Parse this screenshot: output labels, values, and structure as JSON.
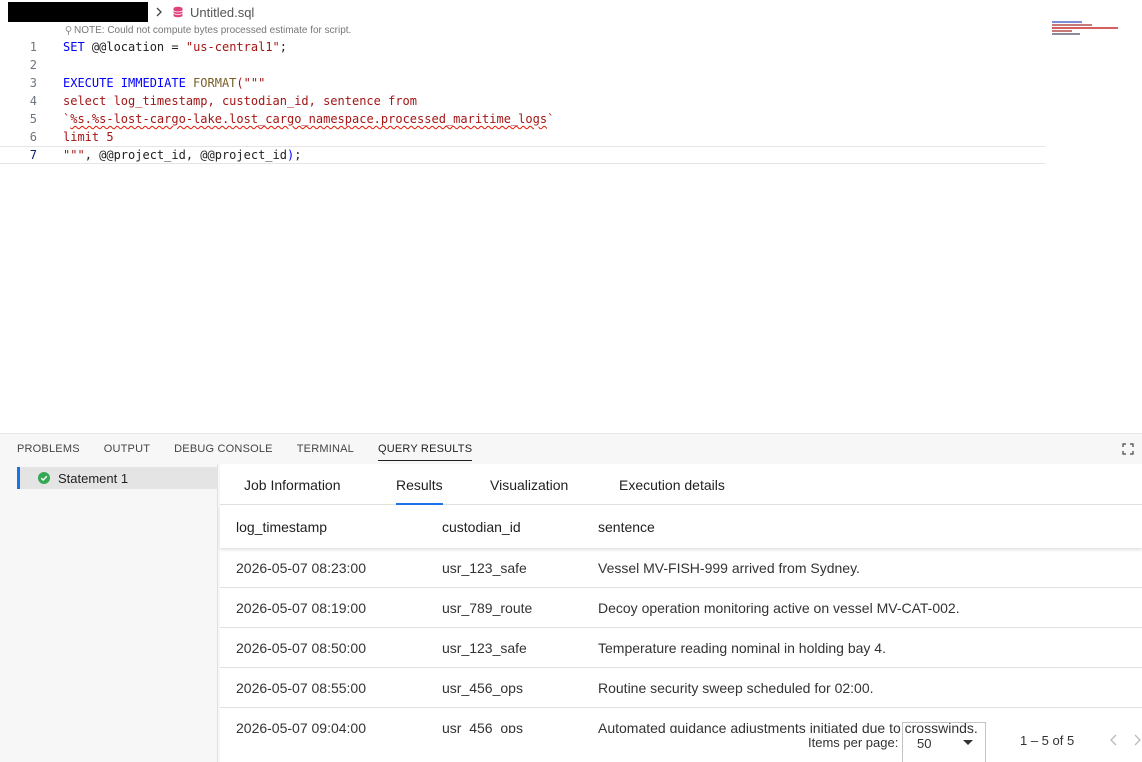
{
  "breadcrumb": {
    "file_name": "Untitled.sql"
  },
  "editor": {
    "note": "NOTE: Could not compute bytes processed estimate for script.",
    "line_numbers": [
      "1",
      "2",
      "3",
      "4",
      "5",
      "6",
      "7"
    ],
    "code": {
      "l1_kw": "SET",
      "l1_var": " @@location",
      "l1_eq": " = ",
      "l1_str": "\"us-central1\"",
      "l1_end": ";",
      "l3_kw": "EXECUTE IMMEDIATE",
      "l3_fn": " FORMAT",
      "l3_str": "(\"\"\"",
      "l4": "select log_timestamp, custodian_id, sentence from",
      "l5_tick1": "`",
      "l5_path": "%s.%s-lost-cargo-lake.lost_cargo_namespace.processed_maritime_logs",
      "l5_tick2": "`",
      "l6": "limit 5",
      "l7_str": "\"\"\"",
      "l7_rest": ", @@project_id, @@project_id",
      "l7_paren": ")",
      "l7_end": ";"
    }
  },
  "panel": {
    "tabs": [
      "PROBLEMS",
      "OUTPUT",
      "DEBUG CONSOLE",
      "TERMINAL",
      "QUERY RESULTS"
    ],
    "active_tab": "QUERY RESULTS",
    "statement": "Statement 1"
  },
  "results": {
    "tabs": [
      "Job Information",
      "Results",
      "Visualization",
      "Execution details"
    ],
    "active_tab": "Results",
    "columns": [
      "log_timestamp",
      "custodian_id",
      "sentence"
    ],
    "rows": [
      [
        "2026-05-07 08:23:00",
        "usr_123_safe",
        "Vessel MV-FISH-999 arrived from Sydney."
      ],
      [
        "2026-05-07 08:19:00",
        "usr_789_route",
        "Decoy operation monitoring active on vessel MV-CAT-002."
      ],
      [
        "2026-05-07 08:50:00",
        "usr_123_safe",
        "Temperature reading nominal in holding bay 4."
      ],
      [
        "2026-05-07 08:55:00",
        "usr_456_ops",
        "Routine security sweep scheduled for 02:00."
      ],
      [
        "2026-05-07 09:04:00",
        "usr_456_ops",
        "Automated guidance adjustments initiated due to crosswinds."
      ]
    ],
    "pager": {
      "items_per_page_label": "Items per page:",
      "items_per_page": "50",
      "range": "1 – 5 of 5"
    }
  },
  "colors": {
    "accent": "#1a73e8",
    "keyword": "#0000ff",
    "string": "#a31515",
    "success": "#34a853"
  }
}
